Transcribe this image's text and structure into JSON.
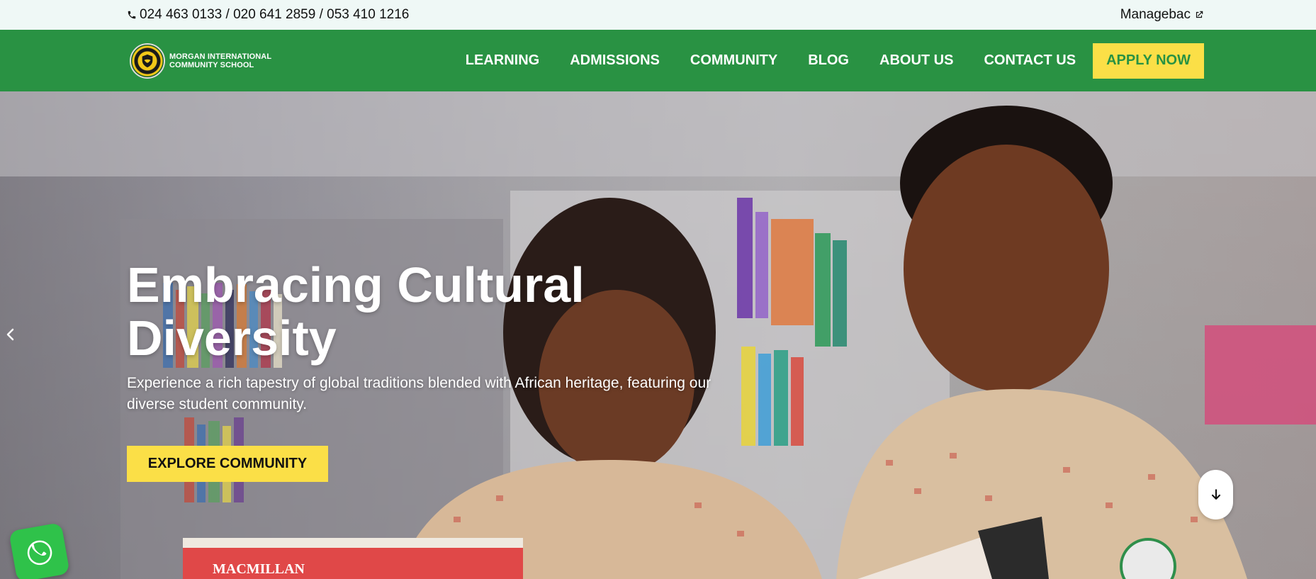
{
  "topbar": {
    "phones": "024 463 0133 / 020 641 2859 / 053 410 1216",
    "managebac_label": "Managebac"
  },
  "logo": {
    "line1": "MORGAN INTERNATIONAL",
    "line2": "COMMUNITY SCHOOL"
  },
  "nav": {
    "items": [
      {
        "label": "LEARNING"
      },
      {
        "label": "ADMISSIONS"
      },
      {
        "label": "COMMUNITY"
      },
      {
        "label": "BLOG"
      },
      {
        "label": "ABOUT US"
      },
      {
        "label": "CONTACT US"
      }
    ],
    "apply_label": "APPLY NOW"
  },
  "hero": {
    "title_line1": "Embracing Cultural",
    "title_line2": "Diversity",
    "subtitle": "Experience a rich tapestry of global traditions blended with African heritage, featuring our diverse student community.",
    "cta_label": "EXPLORE COMMUNITY",
    "book_label": "MACMILLAN"
  },
  "colors": {
    "brand_green": "#299243",
    "accent_yellow": "#fbdf47",
    "topbar_bg": "#eff8f6",
    "call_widget_green": "#2fc24a"
  },
  "icons": {
    "phone": "phone-icon",
    "external": "external-link-icon",
    "prev": "chevron-left-icon",
    "scroll": "arrow-down-icon",
    "call": "phone-call-icon"
  }
}
